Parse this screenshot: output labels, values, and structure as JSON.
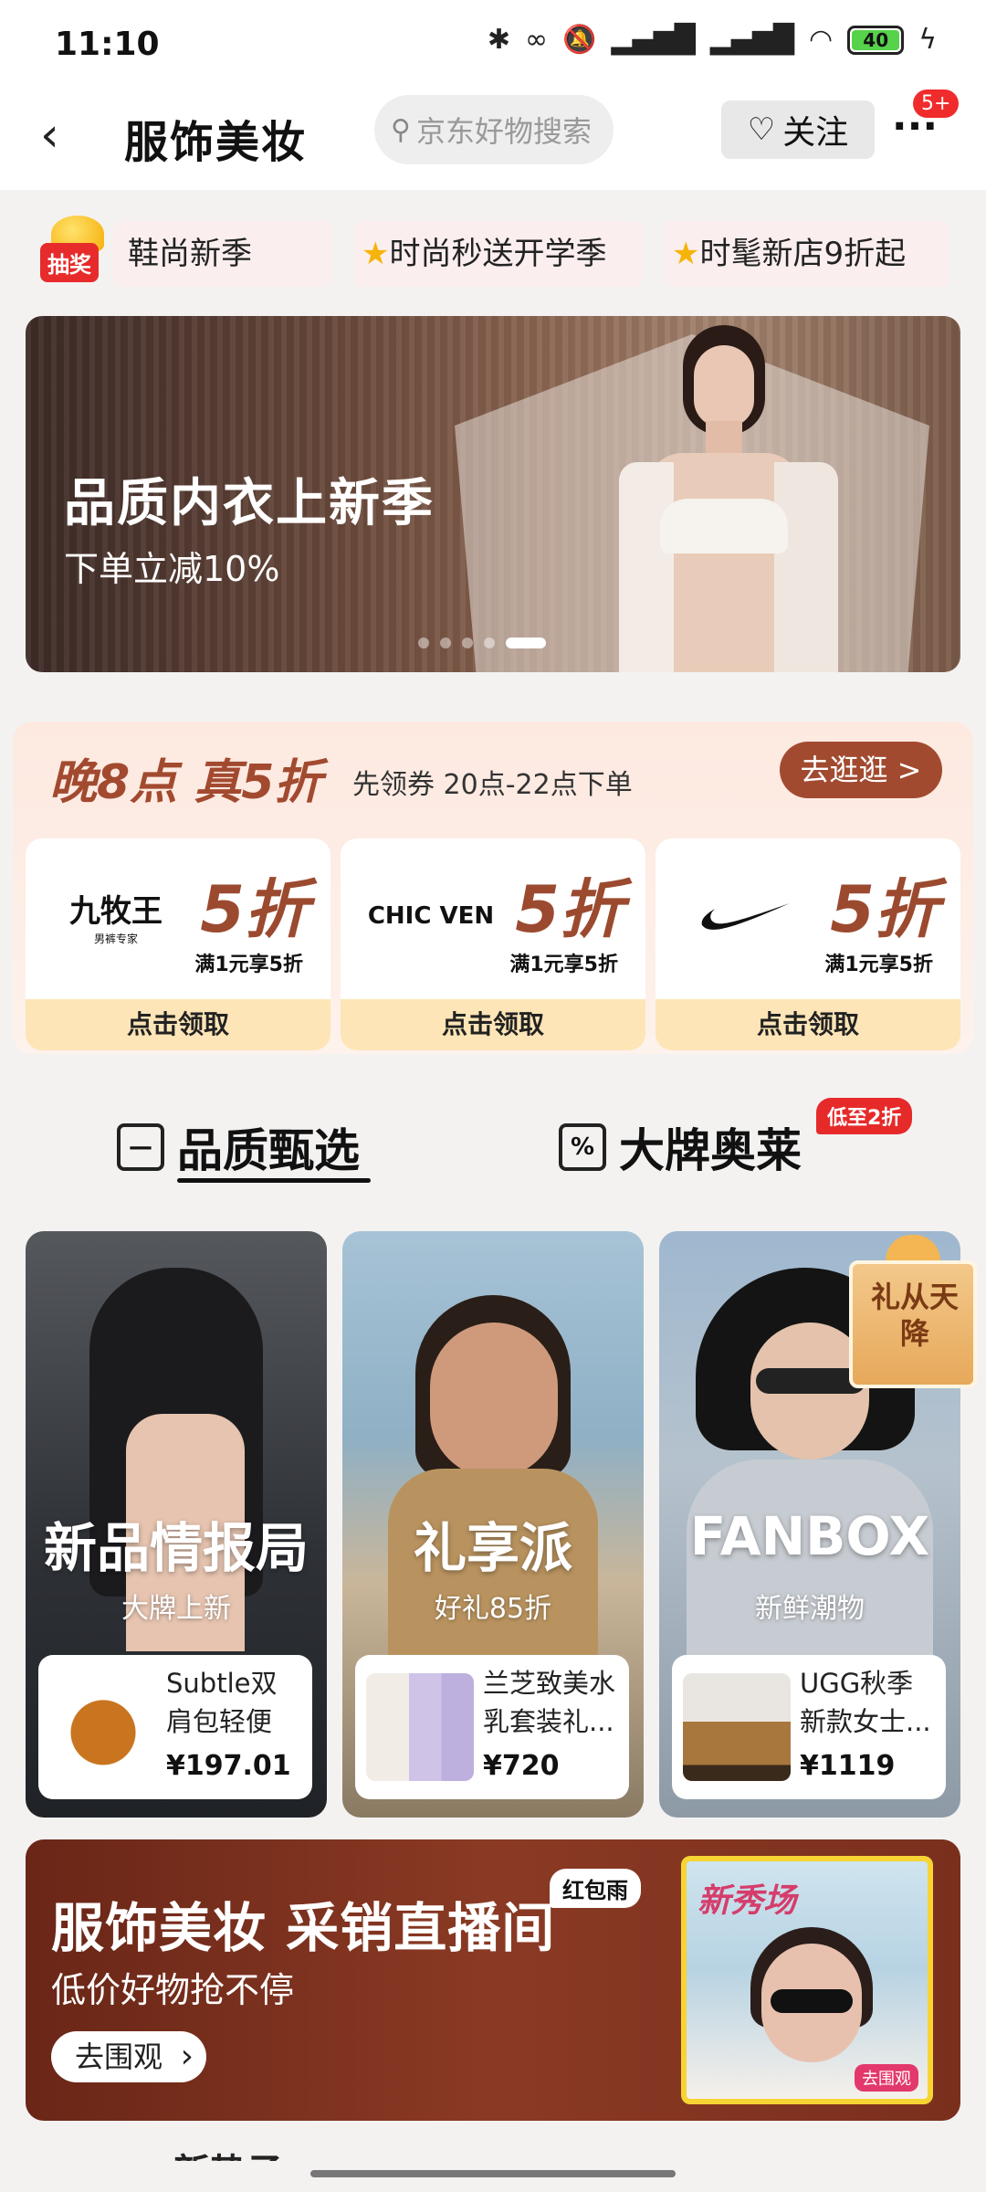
{
  "status_bar": {
    "time": "11:10",
    "battery": "40",
    "icons": [
      "bluetooth-icon",
      "link-icon",
      "mute-icon",
      "signal-hd-icon",
      "signal-hd-icon",
      "wifi-icon",
      "battery-icon",
      "charging-icon"
    ]
  },
  "header": {
    "title": "服饰美妆",
    "search_placeholder": "京东好物搜索",
    "follow_label": "关注",
    "more_badge": "5+"
  },
  "promo_strip": {
    "lottery_label": "抽奖",
    "items": [
      "鞋尚新季",
      "时尚秒送开学季",
      "时髦新店9折起"
    ]
  },
  "banner": {
    "title": "品质内衣上新季",
    "subtitle": "下单立减10%",
    "slide_count": 5,
    "active_slide": 5
  },
  "coupon_section": {
    "title": "晚8点 真5折",
    "subtitle": "先领券 20点-22点下单",
    "go_label": "去逛逛 >",
    "cards": [
      {
        "brand": "九牧王",
        "brand_sub": "男裤专家",
        "discount": "5折",
        "condition": "满1元享5折",
        "claim": "点击领取"
      },
      {
        "brand": "CHIC VEN",
        "brand_sub": "",
        "discount": "5折",
        "condition": "满1元享5折",
        "claim": "点击领取"
      },
      {
        "brand": "",
        "brand_sub": "",
        "discount": "5折",
        "condition": "满1元享5折",
        "claim": "点击领取"
      }
    ]
  },
  "tabs": {
    "items": [
      {
        "label": "品质甄选",
        "icon": "shopping-bag-icon",
        "active": true
      },
      {
        "label": "大牌奥莱",
        "icon": "discount-tag-icon",
        "active": false
      }
    ],
    "outlet_badge": "低至2折"
  },
  "feature_cards": [
    {
      "title": "新品情报局",
      "subtitle": "大牌上新",
      "product_name": "Subtle双肩包轻便大...",
      "price": "¥197.01",
      "bg": "#3b3f45"
    },
    {
      "title": "礼享派",
      "subtitle": "好礼85折",
      "product_name": "兰芝致美水乳套装礼...",
      "price": "¥720",
      "bg": "#9fb6c6"
    },
    {
      "title": "FANBOX",
      "subtitle": "新鲜潮物",
      "product_name": "UGG秋季新款女士...",
      "price": "¥1119",
      "bg": "#a9b6c2"
    }
  ],
  "gift_badge": "礼从天降",
  "live_banner": {
    "title": "服饰美妆 采销直播间",
    "subtitle": "低价好物抢不停",
    "button": "去围观",
    "tag": "红包雨",
    "thumb_title": "新秀场",
    "thumb_badge": "去围观"
  },
  "bottom_peek": "新势子"
}
